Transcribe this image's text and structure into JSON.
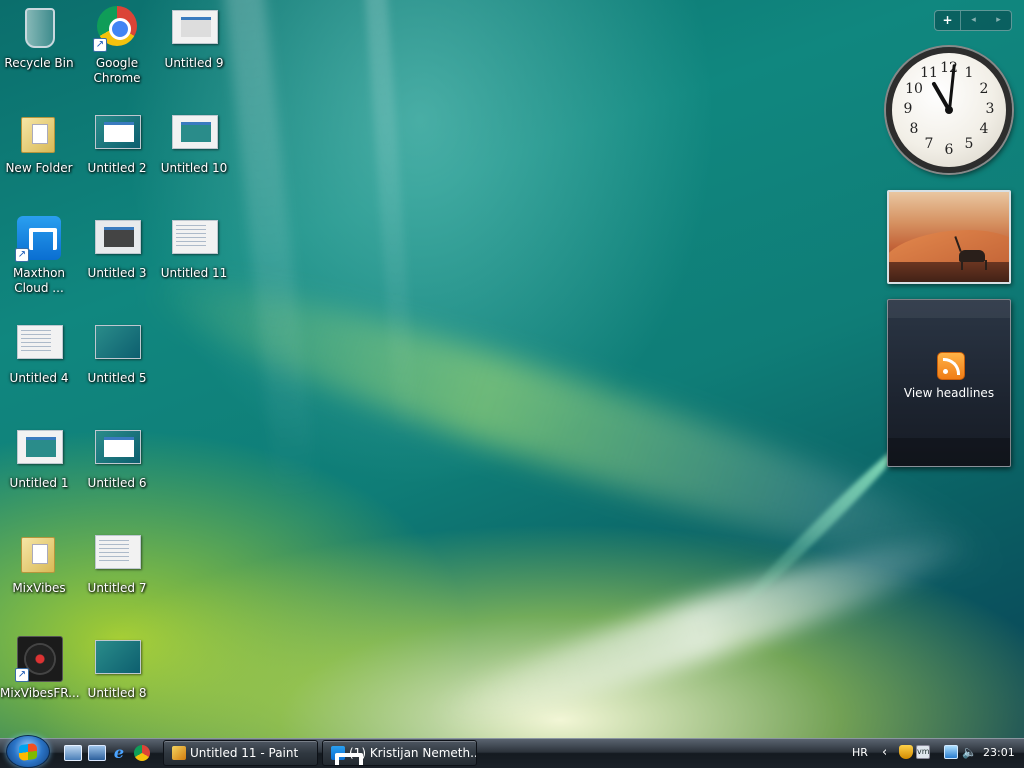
{
  "desktop": {
    "icons": [
      {
        "label": "Recycle Bin",
        "icon": "recycle-bin-icon"
      },
      {
        "label": "Google Chrome",
        "icon": "chrome-icon"
      },
      {
        "label": "Untitled 9",
        "icon": "image-file-icon"
      },
      {
        "label": "New Folder",
        "icon": "folder-icon"
      },
      {
        "label": "Untitled 2",
        "icon": "image-file-icon"
      },
      {
        "label": "Untitled 10",
        "icon": "image-file-icon"
      },
      {
        "label": "Maxthon Cloud ...",
        "icon": "maxthon-icon"
      },
      {
        "label": "Untitled 3",
        "icon": "image-file-icon"
      },
      {
        "label": "Untitled 11",
        "icon": "image-file-icon"
      },
      {
        "label": "Untitled 4",
        "icon": "image-file-icon"
      },
      {
        "label": "Untitled 5",
        "icon": "image-file-icon"
      },
      {
        "label": "Untitled 1",
        "icon": "image-file-icon"
      },
      {
        "label": "Untitled 6",
        "icon": "image-file-icon"
      },
      {
        "label": "MixVibes",
        "icon": "folder-icon"
      },
      {
        "label": "Untitled 7",
        "icon": "image-file-icon"
      },
      {
        "label": "MixVibesFR...",
        "icon": "turntable-icon"
      },
      {
        "label": "Untitled 8",
        "icon": "image-file-icon"
      }
    ]
  },
  "sidebar": {
    "add_label": "+",
    "prev_label": "◂",
    "next_label": "▸",
    "clock": {
      "numbers": [
        "12",
        "1",
        "2",
        "3",
        "4",
        "5",
        "6",
        "7",
        "8",
        "9",
        "10",
        "11"
      ]
    },
    "feeds": {
      "label": "View headlines"
    }
  },
  "taskbar": {
    "tasks": [
      {
        "label": "Untitled 11 - Paint",
        "icon": "paint-icon"
      },
      {
        "label": "(1) Kristijan Nemeth...",
        "icon": "maxthon-icon"
      }
    ],
    "tray": {
      "language": "HR",
      "chevron": "‹",
      "vm_label": "vm",
      "time": "23:01"
    }
  },
  "colors": {
    "wallpaper_teal": "#0f7d77",
    "wallpaper_yellow": "#c8e650",
    "taskbar": "#1b2128"
  }
}
